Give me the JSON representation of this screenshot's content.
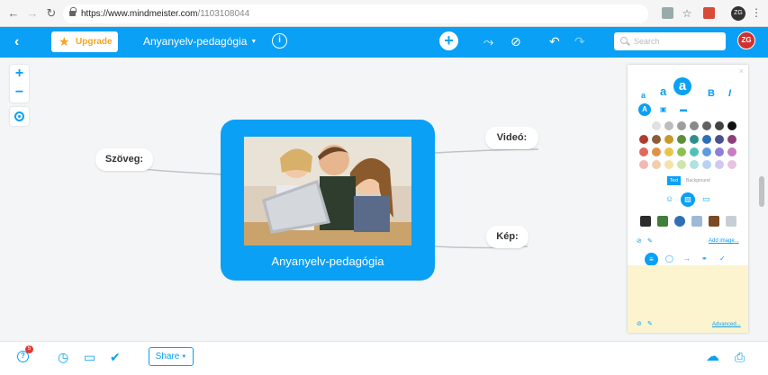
{
  "browser": {
    "url_host": "https://www.mindmeister.com",
    "url_path": "/1103108044",
    "profile_initials": "ZG"
  },
  "toolbar": {
    "upgrade_label": "Upgrade",
    "map_title": "Anyanyelv-pedagógia",
    "search_placeholder": "Search",
    "user_initials": "ZG",
    "accent_color": "#0aa0f5"
  },
  "map": {
    "central_label": "Anyanyelv-pedagógia",
    "nodes": {
      "szoveg": "Szöveg:",
      "video": "Videó:",
      "kep": "Kép:"
    }
  },
  "panel": {
    "font_sizes": [
      "a",
      "a",
      "a"
    ],
    "bold": "B",
    "italic": "I",
    "tab_text": "Text",
    "tab_background": "Background",
    "add_image": "Add image...",
    "advanced": "Advanced..."
  },
  "bottom": {
    "notifications_count": "5",
    "share_label": "Share"
  }
}
